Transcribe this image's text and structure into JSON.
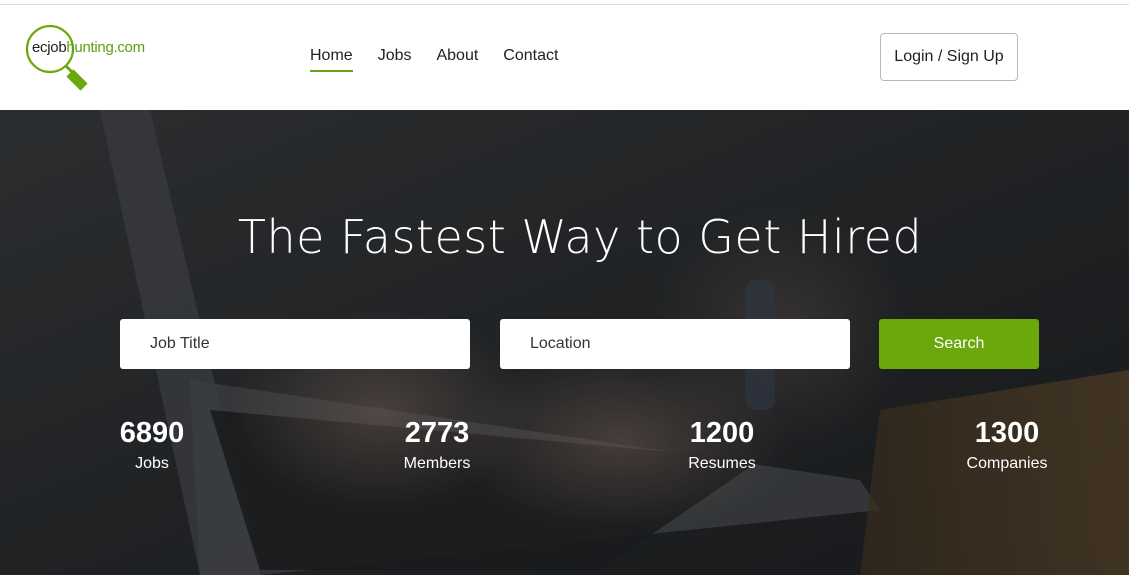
{
  "logo": {
    "text_part1": "ecjob",
    "text_part2": "hunting.com"
  },
  "nav": {
    "items": [
      {
        "label": "Home",
        "active": true
      },
      {
        "label": "Jobs",
        "active": false
      },
      {
        "label": "About",
        "active": false
      },
      {
        "label": "Contact",
        "active": false
      }
    ]
  },
  "header": {
    "login_label": "Login / Sign Up"
  },
  "hero": {
    "title": "The Fastest Way to Get Hired",
    "job_title_placeholder": "Job Title",
    "location_placeholder": "Location",
    "search_label": "Search"
  },
  "stats": [
    {
      "value": "6890",
      "label": "Jobs"
    },
    {
      "value": "2773",
      "label": "Members"
    },
    {
      "value": "1200",
      "label": "Resumes"
    },
    {
      "value": "1300",
      "label": "Companies"
    }
  ],
  "colors": {
    "accent": "#6aa80b",
    "logo_green": "#5c9e0f"
  },
  "icons": [
    "magnifier-logo-icon"
  ]
}
